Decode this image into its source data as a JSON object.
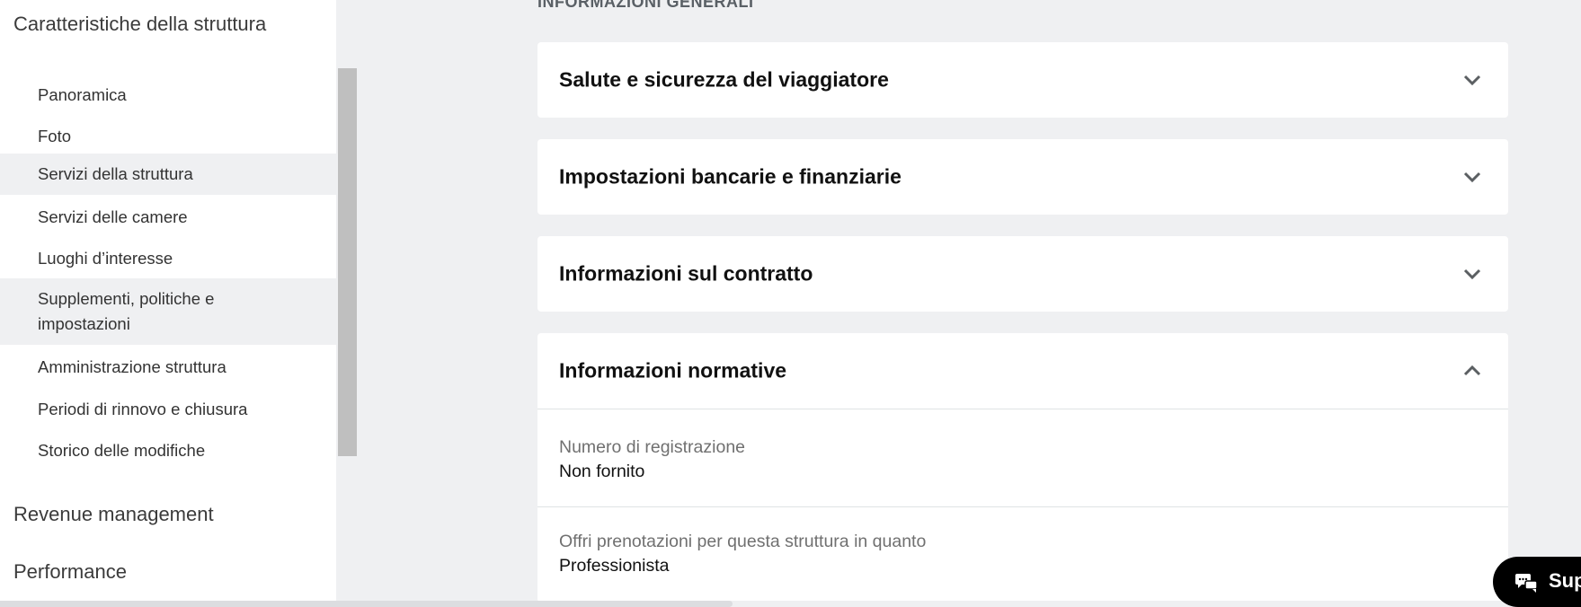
{
  "sidebar": {
    "section_main": "Caratteristiche della struttura",
    "items": [
      {
        "label": "Panoramica",
        "highlighted": false
      },
      {
        "label": "Foto",
        "highlighted": false
      },
      {
        "label": "Servizi della struttura",
        "highlighted": true
      },
      {
        "label": "Servizi delle camere",
        "highlighted": false
      },
      {
        "label": "Luoghi d’interesse",
        "highlighted": false
      },
      {
        "label": "Supplementi, politiche e impostazioni",
        "highlighted": true
      },
      {
        "label": "Amministrazione struttura",
        "highlighted": false
      },
      {
        "label": "Periodi di rinnovo e chiusura",
        "highlighted": false
      },
      {
        "label": "Storico delle modifiche",
        "highlighted": false
      }
    ],
    "section_revenue": "Revenue management",
    "section_performance": "Performance"
  },
  "main": {
    "section_title": "INFORMAZIONI GENERALI",
    "cards": [
      {
        "title": "Salute e sicurezza del viaggiatore",
        "expanded": false
      },
      {
        "title": "Impostazioni bancarie e finanziarie",
        "expanded": false
      },
      {
        "title": "Informazioni sul contratto",
        "expanded": false
      },
      {
        "title": "Informazioni normative",
        "expanded": true,
        "fields": [
          {
            "label": "Numero di registrazione",
            "value": "Non fornito"
          },
          {
            "label": "Offri prenotazioni per questa struttura in quanto",
            "value": "Professionista"
          }
        ]
      }
    ]
  },
  "support": {
    "label": "Supporto",
    "visible_label": "Sup",
    "icon": "chat-bubbles-icon"
  },
  "colors": {
    "background": "#eff0f2",
    "card": "#ffffff",
    "support_button": "#000000",
    "scroll_thumb": "#bfbfbf"
  }
}
